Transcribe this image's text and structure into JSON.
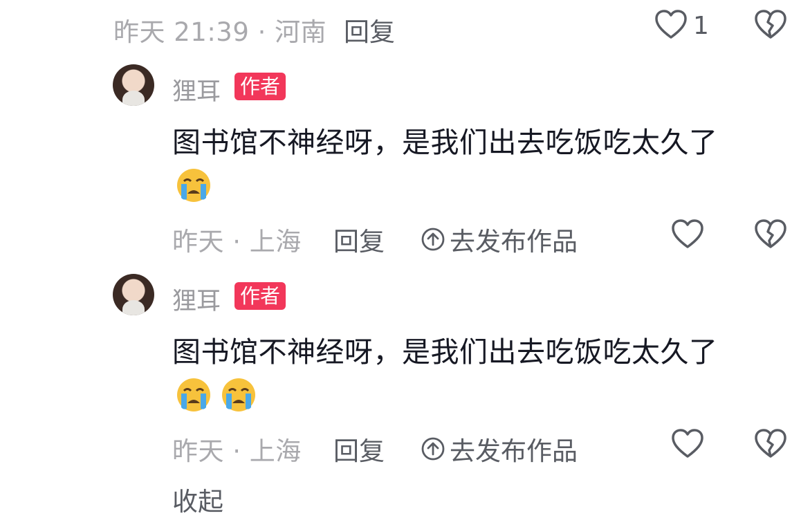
{
  "top_comment": {
    "meta": "昨天 21:39 · 河南",
    "reply_label": "回复",
    "like_count": "1"
  },
  "replies": [
    {
      "author": "狸耳",
      "badge": "作者",
      "text": "图书馆不神经呀，是我们出去吃饭吃太久了",
      "emojis": [
        "crying-face"
      ],
      "meta": "昨天 · 上海",
      "reply_label": "回复",
      "publish_label": "去发布作品"
    },
    {
      "author": "狸耳",
      "badge": "作者",
      "text": "图书馆不神经呀，是我们出去吃饭吃太久了",
      "emojis": [
        "crying-face",
        "crying-face"
      ],
      "meta": "昨天 · 上海",
      "reply_label": "回复",
      "publish_label": "去发布作品"
    }
  ],
  "collapse_label": "收起",
  "colors": {
    "badge": "#f2375a",
    "meta_text": "#a9a9ad",
    "action_text": "#595c63",
    "body_text": "#161823"
  }
}
